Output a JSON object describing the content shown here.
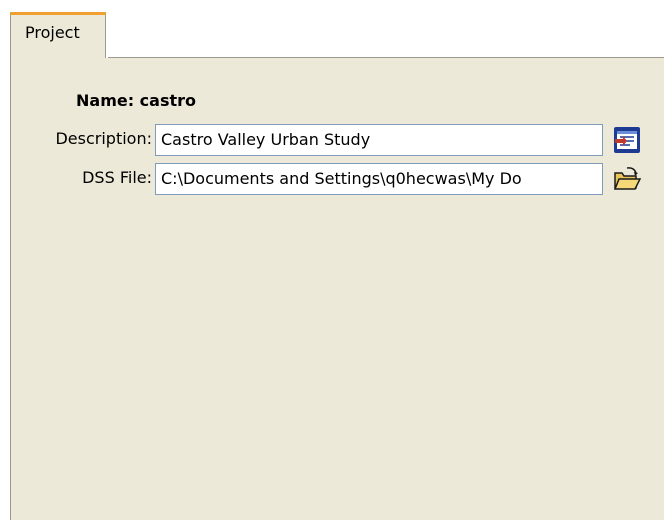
{
  "tabs": [
    {
      "label": "Project"
    }
  ],
  "project": {
    "name_text": "Name: castro",
    "description_label": "Description:",
    "description_value": "Castro Valley Urban Study",
    "dss_label": "DSS File:",
    "dss_value": "C:\\Documents and Settings\\q0hecwas\\My Do"
  },
  "icons": {
    "description_button": "edit-description-icon",
    "dss_button": "open-folder-icon"
  },
  "colors": {
    "panel_background": "#ece9d8",
    "tab_highlight": "#f0a030",
    "field_border": "#7f9db9"
  }
}
